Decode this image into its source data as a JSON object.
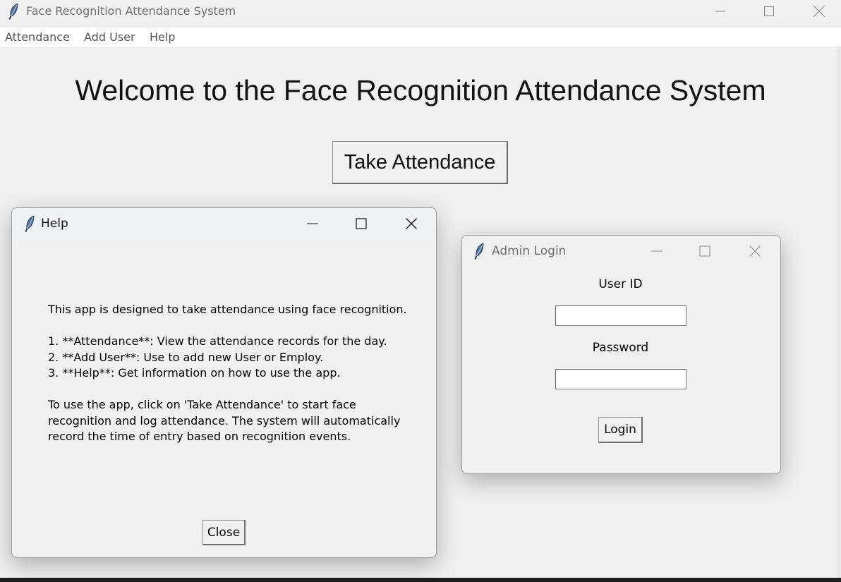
{
  "main_window": {
    "title": "Face Recognition Attendance System",
    "menu": [
      "Attendance",
      "Add User",
      "Help"
    ],
    "welcome_text": "Welcome to the Face Recognition Attendance System",
    "take_attendance_label": "Take Attendance"
  },
  "help_dialog": {
    "title": "Help",
    "text": "This app is designed to take attendance using face recognition.\n\n1. **Attendance**: View the attendance records for the day.\n2. **Add User**: Use to add new User or Employ.\n3. **Help**: Get information on how to use the app.\n\nTo use the app, click on 'Take Attendance' to start face\nrecognition and log attendance. The system will automatically\nrecord the time of entry based on recognition events.",
    "close_label": "Close"
  },
  "login_dialog": {
    "title": "Admin Login",
    "user_id_label": "User ID",
    "user_id_value": "",
    "password_label": "Password",
    "password_value": "",
    "login_label": "Login"
  },
  "icons": {
    "app": "feather-icon",
    "minimize": "minimize-icon",
    "maximize": "maximize-icon",
    "close": "close-icon"
  },
  "colors": {
    "window_bg": "#f0f0f0",
    "menubar_bg": "#ffffff",
    "help_titlebar_bg": "#eef2f5",
    "inactive_title_text": "#6e6e6e"
  }
}
